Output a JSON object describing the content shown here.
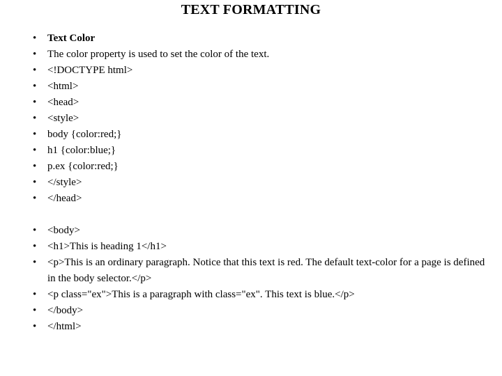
{
  "slide": {
    "title": "TEXT FORMATTING",
    "background_color": "#ffffff",
    "text_color": "#000000",
    "bullet_marker": "•",
    "groups": [
      {
        "name": "head-section",
        "items": [
          {
            "text": "Text Color",
            "bold": true
          },
          {
            "text": "The color property is used to set the color of the text.",
            "bold": false
          },
          {
            "text": "<!DOCTYPE html>",
            "bold": false
          },
          {
            "text": "<html>",
            "bold": false
          },
          {
            "text": "<head>",
            "bold": false
          },
          {
            "text": "<style>",
            "bold": false
          },
          {
            "text": "body {color:red;}",
            "bold": false
          },
          {
            "text": "h1 {color:blue;}",
            "bold": false
          },
          {
            "text": "p.ex {color:red;}",
            "bold": false
          },
          {
            "text": "</style>",
            "bold": false
          },
          {
            "text": "</head>",
            "bold": false
          }
        ]
      },
      {
        "name": "body-section",
        "items": [
          {
            "text": "<body>",
            "bold": false
          },
          {
            "text": "<h1>This is heading 1</h1>",
            "bold": false
          },
          {
            "text": "<p>This is an ordinary paragraph. Notice that this text is red. The default text-color for a page is defined in the body selector.</p>",
            "bold": false
          },
          {
            "text": "<p class=\"ex\">This is a paragraph with class=\"ex\". This text is blue.</p>",
            "bold": false
          },
          {
            "text": "</body>",
            "bold": false
          },
          {
            "text": "</html>",
            "bold": false
          }
        ]
      }
    ]
  }
}
